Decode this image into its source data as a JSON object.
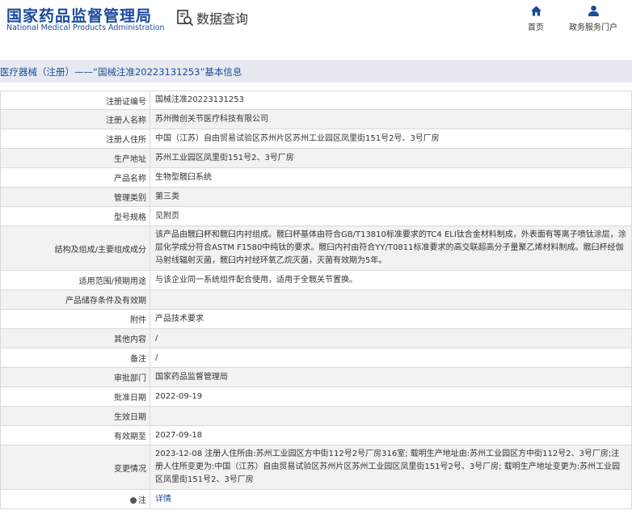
{
  "header": {
    "logo_cn": "国家药品监督管理局",
    "logo_en": "National Medical Products Administration",
    "query_label": "数据查询",
    "nav": [
      {
        "label": "首页"
      },
      {
        "label": "政务服务门户"
      }
    ]
  },
  "title": "医疗器械（注册）——“国械注准20223131253”基本信息",
  "rows": [
    {
      "label": "注册证编号",
      "value": "国械注准20223131253"
    },
    {
      "label": "注册人名称",
      "value": "苏州微创关节医疗科技有限公司"
    },
    {
      "label": "注册人住所",
      "value": "中国（江苏）自由贸易试验区苏州片区苏州工业园区凤里街151号2号、3号厂房"
    },
    {
      "label": "生产地址",
      "value": "苏州工业园区凤里街151号2、3号厂房"
    },
    {
      "label": "产品名称",
      "value": "生物型髋臼系统"
    },
    {
      "label": "管理类别",
      "value": "第三类"
    },
    {
      "label": "型号规格",
      "value": "见附页"
    },
    {
      "label": "结构及组成/主要组成成分",
      "value": "该产品由髋臼杯和髋臼内衬组成。髋臼杯基体由符合GB/T13810标准要求的TC4 ELI钛合金材料制成，外表面有等离子喷钛涂层，涂层化学成分符合ASTM F1580中纯钛的要求。髋臼内衬由符合YY/T0811标准要求的高交联超高分子量聚乙烯材料制成。髋臼杯经伽马射线辐射灭菌，髋臼内衬经环氧乙烷灭菌，灭菌有效期为5年。"
    },
    {
      "label": "适用范围/预期用途",
      "value": "与该企业同一系统组件配合使用，适用于全髋关节置换。"
    },
    {
      "label": "产品储存条件及有效期",
      "value": ""
    },
    {
      "label": "附件",
      "value": "产品技术要求"
    },
    {
      "label": "其他内容",
      "value": "/"
    },
    {
      "label": "备注",
      "value": "/"
    },
    {
      "label": "审批部门",
      "value": "国家药品监督管理局"
    },
    {
      "label": "批准日期",
      "value": "2022-09-19"
    },
    {
      "label": "生效日期",
      "value": ""
    },
    {
      "label": "有效期至",
      "value": "2027-09-18"
    },
    {
      "label": "变更情况",
      "value": "2023-12-08 注册人住所由:苏州工业园区方中街112号2号厂房316室; 载明生产地址由:苏州工业园区方中街112号2、3号厂房;注册人住所变更为:中国（江苏）自由贸易试验区苏州片区苏州工业园区凤里街151号2号、3号厂房; 载明生产地址变更为:苏州工业园区凤里街151号2、3号厂房"
    }
  ],
  "note": {
    "label": "注",
    "link": "详情"
  },
  "colors": {
    "brand": "#1a4a9c",
    "title_bg": "#e6eaf0",
    "alt_row": "#f2f2f2",
    "border": "#d9d9d9"
  }
}
